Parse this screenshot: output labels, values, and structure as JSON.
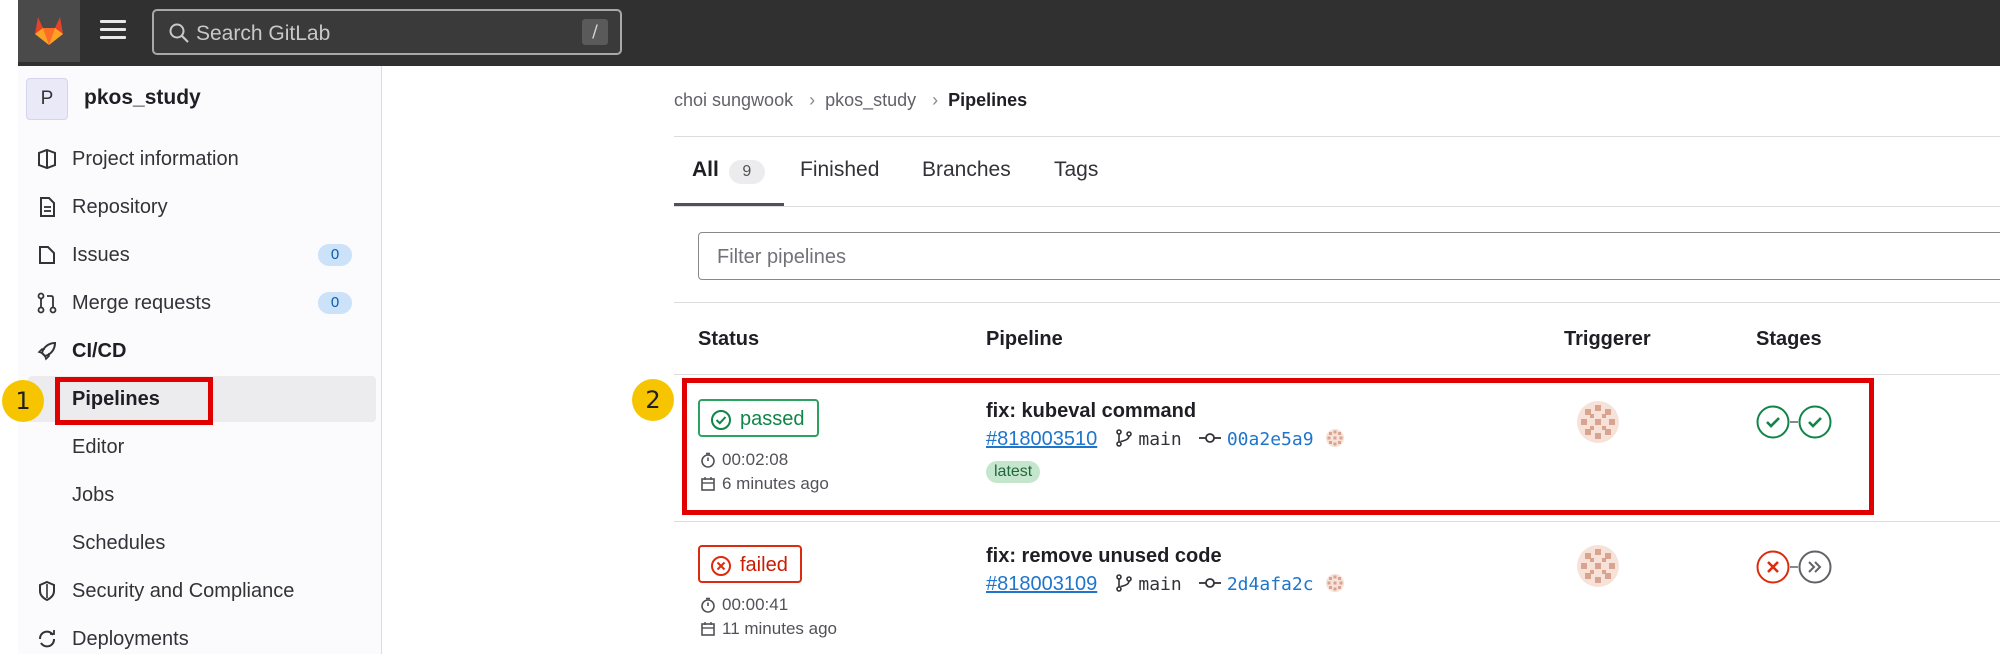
{
  "header": {
    "search_placeholder": "Search GitLab",
    "search_shortcut": "/"
  },
  "sidebar": {
    "project_avatar_letter": "P",
    "project_name": "pkos_study",
    "items": [
      {
        "label": "Project information",
        "icon": "project-info-icon"
      },
      {
        "label": "Repository",
        "icon": "document-icon"
      },
      {
        "label": "Issues",
        "icon": "issues-icon",
        "count": "0"
      },
      {
        "label": "Merge requests",
        "icon": "merge-request-icon",
        "count": "0"
      },
      {
        "label": "CI/CD",
        "icon": "rocket-icon"
      },
      {
        "label": "Pipelines"
      },
      {
        "label": "Editor"
      },
      {
        "label": "Jobs"
      },
      {
        "label": "Schedules"
      },
      {
        "label": "Security and Compliance",
        "icon": "shield-icon"
      },
      {
        "label": "Deployments",
        "icon": "deployments-icon"
      }
    ]
  },
  "breadcrumb": {
    "items": [
      "choi sungwook",
      "pkos_study",
      "Pipelines"
    ],
    "separator": "›"
  },
  "tabs": [
    {
      "label": "All",
      "count": "9",
      "active": true
    },
    {
      "label": "Finished"
    },
    {
      "label": "Branches"
    },
    {
      "label": "Tags"
    }
  ],
  "filter": {
    "placeholder": "Filter pipelines"
  },
  "table": {
    "headers": [
      "Status",
      "Pipeline",
      "Triggerer",
      "Stages"
    ],
    "rows": [
      {
        "status": "passed",
        "duration": "00:02:08",
        "finished": "6 minutes ago",
        "commit_title": "fix: kubeval command",
        "pipeline_id": "#818003510",
        "ref": "main",
        "sha": "00a2e5a9",
        "badge": "latest",
        "stages": [
          "success",
          "success"
        ]
      },
      {
        "status": "failed",
        "duration": "00:00:41",
        "finished": "11 minutes ago",
        "commit_title": "fix: remove unused code",
        "pipeline_id": "#818003109",
        "ref": "main",
        "sha": "2d4afa2c",
        "stages": [
          "failed",
          "skipped"
        ]
      }
    ]
  },
  "annotations": [
    "1",
    "2"
  ],
  "colors": {
    "header_bg": "#303030",
    "passed": "#108548",
    "failed": "#dd2b0e",
    "link": "#1f75cb",
    "annotation_box": "#e00000",
    "annotation_marker": "#f7c500"
  }
}
